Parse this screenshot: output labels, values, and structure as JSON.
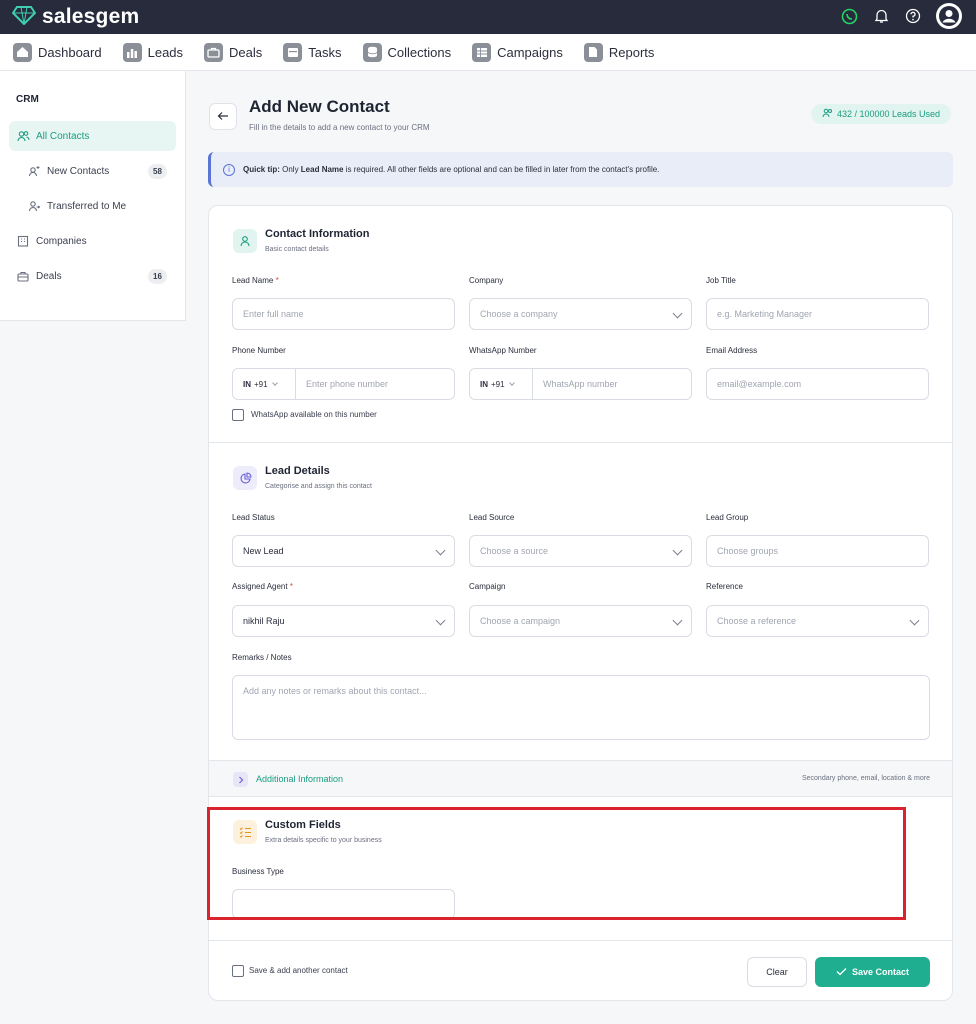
{
  "brand": {
    "name": "salesgem"
  },
  "topbar": {
    "icons": [
      "whatsapp-icon",
      "bell-icon",
      "help-icon",
      "user-avatar-icon"
    ]
  },
  "nav": {
    "items": [
      {
        "label": "Dashboard",
        "icon": "home-icon"
      },
      {
        "label": "Leads",
        "icon": "leads-icon"
      },
      {
        "label": "Deals",
        "icon": "briefcase-icon"
      },
      {
        "label": "Tasks",
        "icon": "tasks-icon"
      },
      {
        "label": "Collections",
        "icon": "database-icon"
      },
      {
        "label": "Campaigns",
        "icon": "table-icon"
      },
      {
        "label": "Reports",
        "icon": "document-icon"
      }
    ]
  },
  "sidebar": {
    "title": "CRM",
    "items": [
      {
        "label": "All Contacts",
        "icon": "users-icon",
        "active": true
      },
      {
        "label": "New Contacts",
        "icon": "sparkle-user-icon",
        "count": "58"
      },
      {
        "label": "Transferred to Me",
        "icon": "user-transfer-icon"
      },
      {
        "label": "Companies",
        "icon": "building-icon"
      },
      {
        "label": "Deals",
        "icon": "briefcase-icon",
        "count": "16"
      }
    ]
  },
  "header": {
    "title": "Add New Contact",
    "subtitle": "Fill in the details to add a new contact to your CRM",
    "usage": "432 / 100000 Leads Used"
  },
  "tip": {
    "prefix": "Quick tip:",
    "text1": " Only ",
    "bold": "Lead Name",
    "text2": " is required. All other fields are optional and can be filled in later from the contact's profile."
  },
  "contact_info": {
    "title": "Contact Information",
    "subtitle": "Basic contact details",
    "lead_name": {
      "label": "Lead Name",
      "placeholder": "Enter full name"
    },
    "company": {
      "label": "Company",
      "placeholder": "Choose a company"
    },
    "job_title": {
      "label": "Job Title",
      "placeholder": "e.g. Marketing Manager"
    },
    "phone": {
      "label": "Phone Number",
      "country": "IN",
      "code": "+91",
      "placeholder": "Enter phone number"
    },
    "whatsapp": {
      "label": "WhatsApp Number",
      "country": "IN",
      "code": "+91",
      "placeholder": "WhatsApp number"
    },
    "email": {
      "label": "Email Address",
      "placeholder": "email@example.com"
    },
    "whatsapp_check": "WhatsApp available on this number"
  },
  "lead_details": {
    "title": "Lead Details",
    "subtitle": "Categorise and assign this contact",
    "status": {
      "label": "Lead Status",
      "value": "New Lead"
    },
    "source": {
      "label": "Lead Source",
      "placeholder": "Choose a source"
    },
    "group": {
      "label": "Lead Group",
      "placeholder": "Choose groups"
    },
    "agent": {
      "label": "Assigned Agent",
      "value": "nikhil Raju"
    },
    "campaign": {
      "label": "Campaign",
      "placeholder": "Choose a campaign"
    },
    "reference": {
      "label": "Reference",
      "placeholder": "Choose a reference"
    },
    "remarks": {
      "label": "Remarks / Notes",
      "placeholder": "Add any notes or remarks about this contact..."
    }
  },
  "additional": {
    "title": "Additional Information",
    "hint": "Secondary phone, email, location & more"
  },
  "custom_fields": {
    "title": "Custom Fields",
    "subtitle": "Extra details specific to your business",
    "business_type": {
      "label": "Business Type",
      "value": ""
    }
  },
  "footer": {
    "save_another": "Save & add another contact",
    "clear": "Clear",
    "save": "Save Contact"
  },
  "colors": {
    "accent": "#1fae8f",
    "topbar": "#272b3b",
    "highlight": "#d9232d",
    "tip_border": "#5b75d6"
  }
}
